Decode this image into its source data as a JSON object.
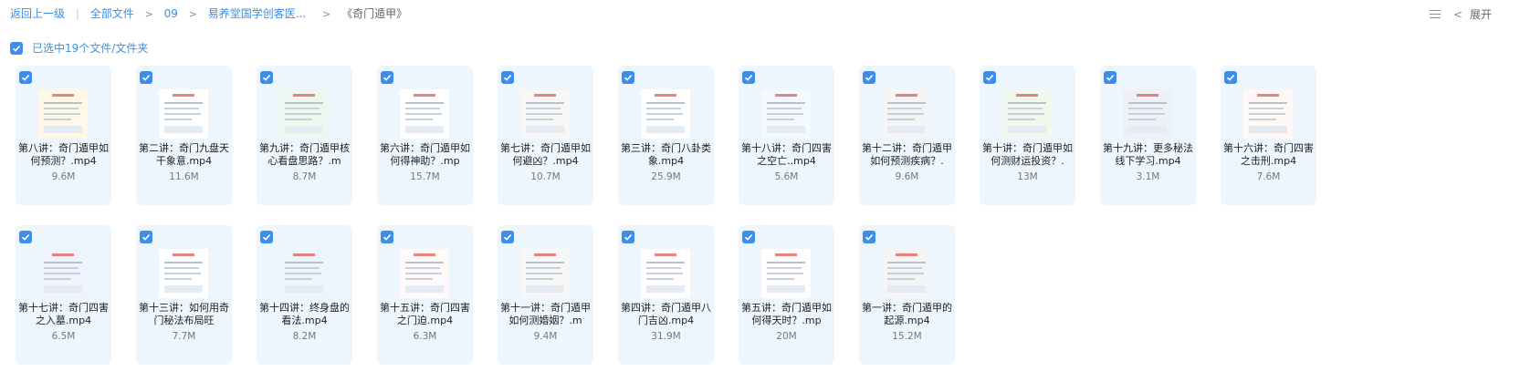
{
  "breadcrumb": {
    "back": "返回上一级",
    "all": "全部文件",
    "level1": "09",
    "level2": "易养堂国学创客医...",
    "current": "《奇门遁甲》"
  },
  "toolbar": {
    "expand_label": "展开"
  },
  "selection": {
    "summary": "已选中19个文件/文件夹"
  },
  "colors": {
    "accent": "#3d8ee8",
    "card_bg": "#eef6fd"
  },
  "files": [
    {
      "name": "第八讲：奇门遁甲如何预测？.mp4",
      "size": "9.6M"
    },
    {
      "name": "第二讲：奇门九盘天干象意.mp4",
      "size": "11.6M"
    },
    {
      "name": "第九讲：奇门遁甲核心看盘思路？.m",
      "size": "8.7M"
    },
    {
      "name": "第六讲：奇门遁甲如何得神助？.mp",
      "size": "15.7M"
    },
    {
      "name": "第七讲：奇门遁甲如何避凶？.mp4",
      "size": "10.7M"
    },
    {
      "name": "第三讲：奇门八卦类象.mp4",
      "size": "25.9M"
    },
    {
      "name": "第十八讲：奇门四害之空亡..mp4",
      "size": "5.6M"
    },
    {
      "name": "第十二讲：奇门遁甲如何预测疾病？.",
      "size": "9.6M"
    },
    {
      "name": "第十讲：奇门遁甲如何测财运投资？.",
      "size": "13M"
    },
    {
      "name": "第十九讲：更多秘法线下学习.mp4",
      "size": "3.1M"
    },
    {
      "name": "第十六讲：奇门四害之击刑.mp4",
      "size": "7.6M"
    },
    {
      "name": "第十七讲：奇门四害之入墓.mp4",
      "size": "6.5M"
    },
    {
      "name": "第十三讲：如何用奇门秘法布局旺",
      "size": "7.7M"
    },
    {
      "name": "第十四讲：终身盘的看法.mp4",
      "size": "8.2M"
    },
    {
      "name": "第十五讲：奇门四害之门迫.mp4",
      "size": "6.3M"
    },
    {
      "name": "第十一讲：奇门遁甲如何测婚姻？.m",
      "size": "9.4M"
    },
    {
      "name": "第四讲：奇门遁甲八门吉凶.mp4",
      "size": "31.9M"
    },
    {
      "name": "第五讲：奇门遁甲如何得天时？.mp",
      "size": "20M"
    },
    {
      "name": "第一讲：奇门遁甲的起源.mp4",
      "size": "15.2M"
    }
  ]
}
